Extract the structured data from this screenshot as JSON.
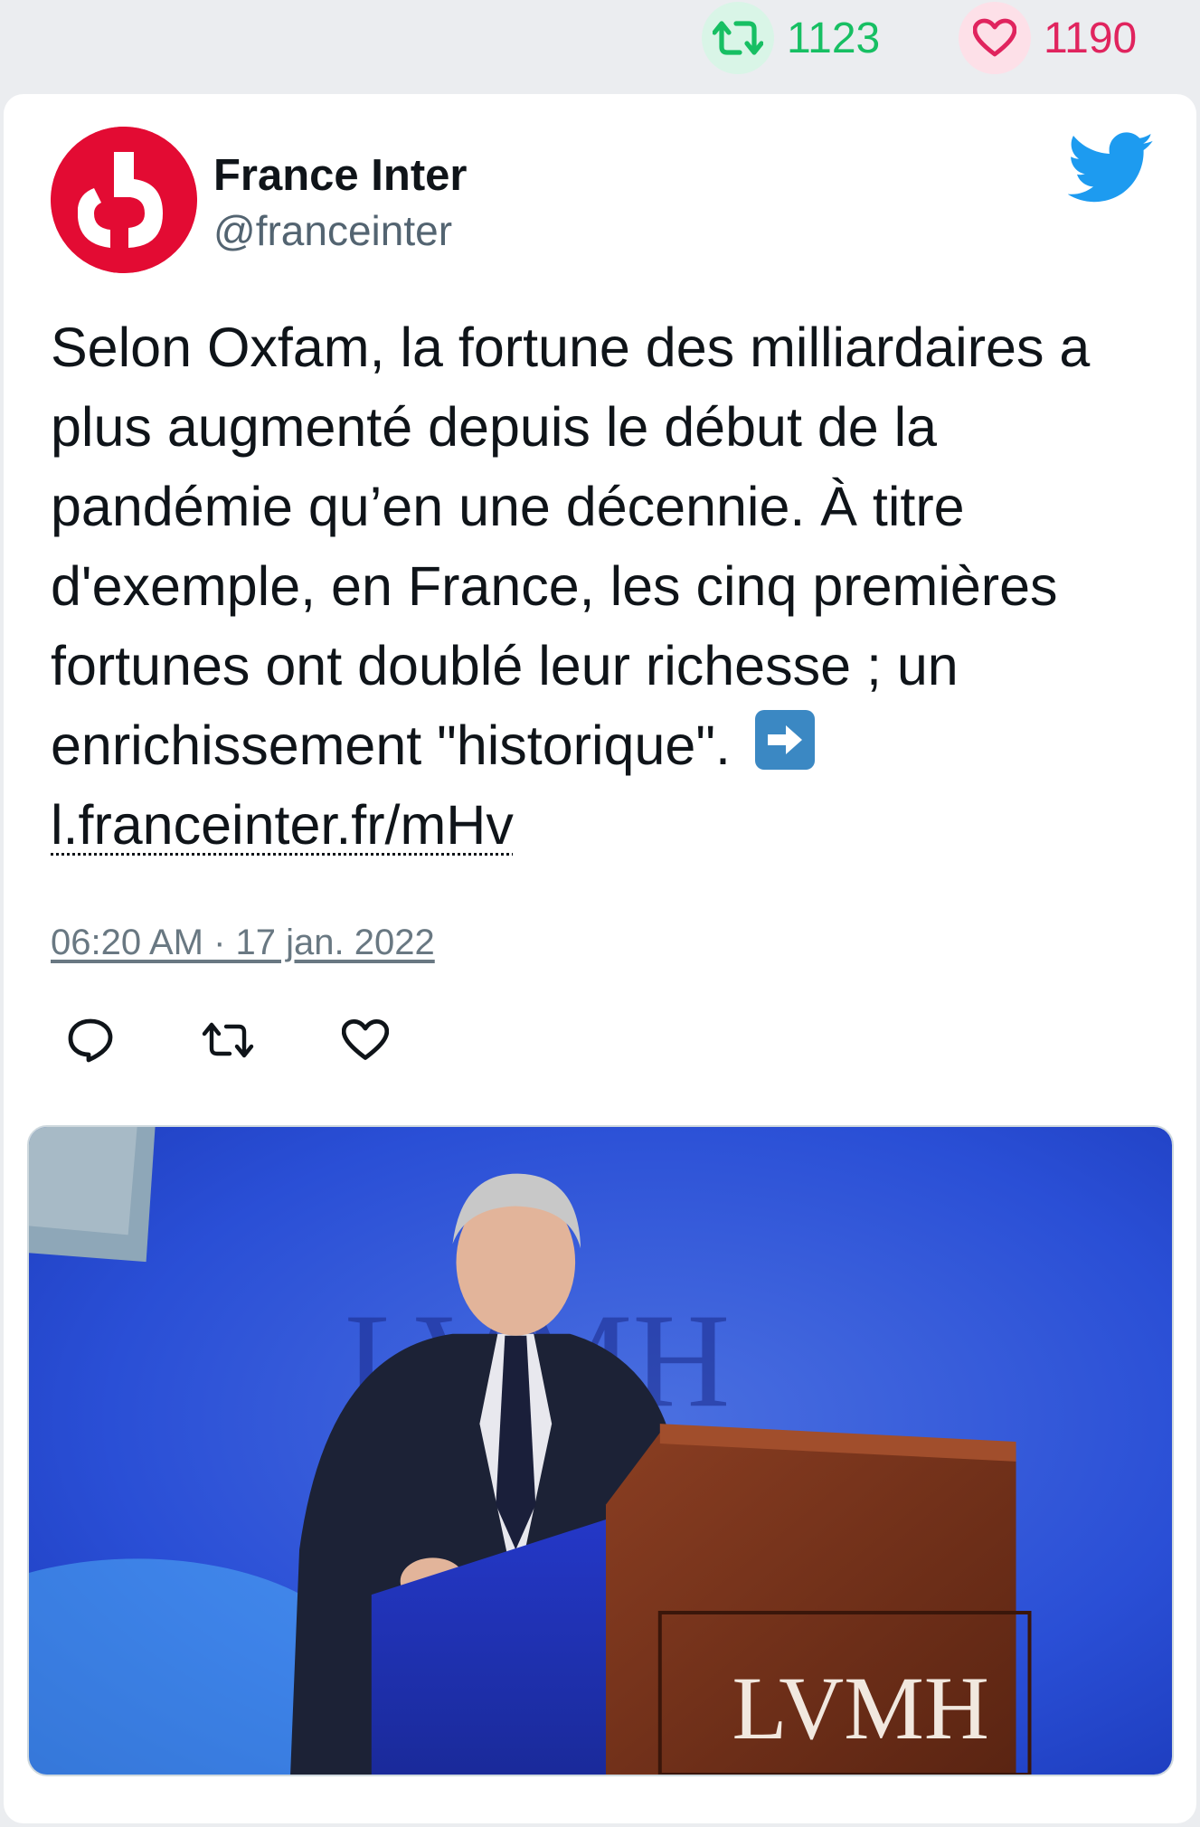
{
  "stats": {
    "retweets": "1123",
    "likes": "1190",
    "retweet_color": "#17bf63",
    "like_color": "#e0245e"
  },
  "author": {
    "name": "France Inter",
    "handle": "@franceinter",
    "avatar_color": "#e30b33"
  },
  "tweet": {
    "text": "Selon Oxfam, la fortune des milliardaires a plus augmenté depuis le début de la pandémie qu’en une décennie. À titre d'exemple, en France, les cinq premières fortunes ont doublé leur richesse ; un enrichissement \"historique\".",
    "link": "l.franceinter.fr/mHv",
    "timestamp": "06:20 AM · 17 jan. 2022"
  },
  "actions": [
    "reply-icon",
    "retweet-icon",
    "like-icon"
  ],
  "media": {
    "sign_text": "LVMH",
    "backdrop_text": "LVMH"
  },
  "colors": {
    "twitter_blue": "#1d9bf0",
    "text": "#0f1419",
    "muted": "#536471"
  }
}
